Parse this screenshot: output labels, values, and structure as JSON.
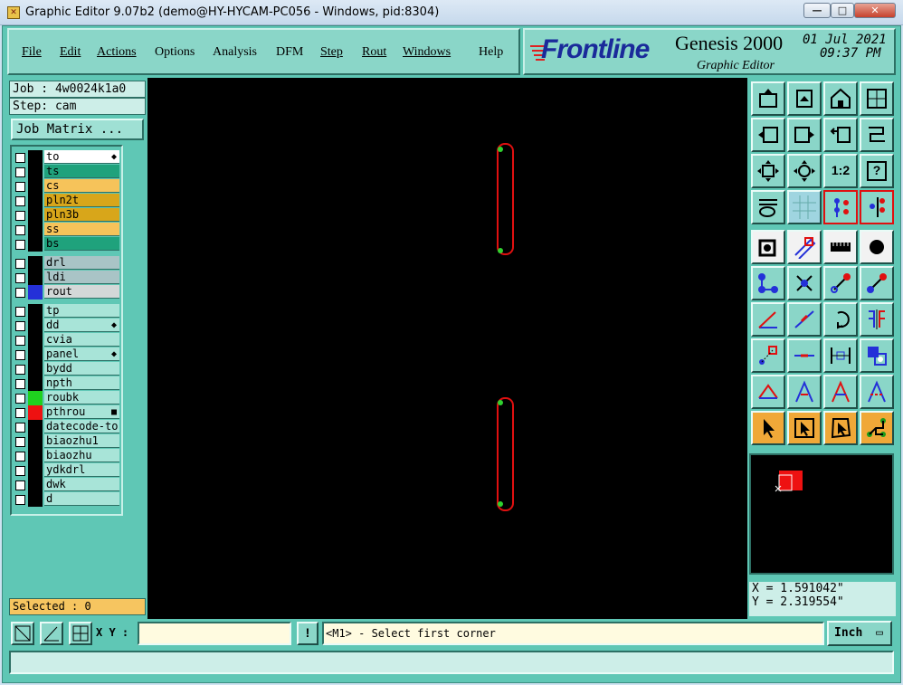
{
  "window": {
    "title": "Graphic Editor 9.07b2 (demo@HY-HYCAM-PC056 - Windows, pid:8304)",
    "minimize_label": "—",
    "maximize_label": "□",
    "close_label": "✕"
  },
  "menu": {
    "items": [
      {
        "label": "File"
      },
      {
        "label": "Edit"
      },
      {
        "label": "Actions"
      },
      {
        "label": "Options"
      },
      {
        "label": "Analysis"
      },
      {
        "label": "DFM"
      },
      {
        "label": "Step"
      },
      {
        "label": "Rout"
      },
      {
        "label": "Windows"
      },
      {
        "label": "Help"
      }
    ]
  },
  "brand": {
    "logo": "Frontline",
    "product": "Genesis 2000",
    "subtitle": "Graphic Editor",
    "date": "01 Jul 2021",
    "time": "09:37 PM"
  },
  "job": {
    "job_label": "Job : 4w0024k1a0",
    "step_label": "Step: cam",
    "matrix_button": "Job Matrix ..."
  },
  "layers": {
    "group1": [
      {
        "name": "to",
        "bg": "#ffffff",
        "mark": "◆"
      },
      {
        "name": "ts",
        "bg": "#1fa27c",
        "mark": ""
      },
      {
        "name": "cs",
        "bg": "#f6c35a",
        "mark": ""
      },
      {
        "name": "pln2t",
        "bg": "#d8a61a",
        "mark": ""
      },
      {
        "name": "pln3b",
        "bg": "#d8a61a",
        "mark": ""
      },
      {
        "name": "ss",
        "bg": "#f6c35a",
        "mark": ""
      },
      {
        "name": "bs",
        "bg": "#1fa27c",
        "mark": ""
      }
    ],
    "group2": [
      {
        "name": "drl",
        "bg": "#a9c4c6",
        "mark": "",
        "swatch": "#000000"
      },
      {
        "name": "ldi",
        "bg": "#a9c4c6",
        "mark": "",
        "swatch": "#000000"
      },
      {
        "name": "rout",
        "bg": "#d3d8d8",
        "mark": "",
        "swatch": "#2430d8"
      }
    ],
    "group3": [
      {
        "name": "tp",
        "mark": "",
        "swatch": "#000000"
      },
      {
        "name": "dd",
        "mark": "◆",
        "swatch": "#000000"
      },
      {
        "name": "cvia",
        "mark": "",
        "swatch": "#000000"
      },
      {
        "name": "panel",
        "mark": "◆",
        "swatch": "#000000"
      },
      {
        "name": "bydd",
        "mark": "",
        "swatch": "#000000"
      },
      {
        "name": "npth",
        "mark": "",
        "swatch": "#000000"
      },
      {
        "name": "roubk",
        "mark": "",
        "swatch": "#1fd11f"
      },
      {
        "name": "pthrou",
        "mark": "■",
        "swatch": "#ee1111"
      },
      {
        "name": "datecode-to",
        "mark": "",
        "swatch": "#000000"
      },
      {
        "name": "biaozhu1",
        "mark": "",
        "swatch": "#000000"
      },
      {
        "name": "biaozhu",
        "mark": "",
        "swatch": "#000000"
      },
      {
        "name": "ydkdrl",
        "mark": "",
        "swatch": "#000000"
      },
      {
        "name": "dwk",
        "mark": "",
        "swatch": "#000000"
      },
      {
        "name": "d",
        "mark": "",
        "swatch": "#000000"
      }
    ],
    "group3_bg": "#a8e4d8"
  },
  "selection": {
    "label": "Selected : 0"
  },
  "coordinates": {
    "x_label": "X = 1.591042\"",
    "y_label": "Y = 2.319554\""
  },
  "toolbar": {
    "scale_label": "1:2",
    "help_label": "?"
  },
  "bottom": {
    "xy_label": "X Y :",
    "xy_value": "",
    "warn_label": "!",
    "prompt": "<M1> - Select first corner",
    "unit": "Inch"
  },
  "status": {
    "text": ""
  },
  "colors": {
    "panel_teal": "#5fc7b5",
    "feature_red": "#e01010",
    "pad_green": "#2fd12f"
  }
}
